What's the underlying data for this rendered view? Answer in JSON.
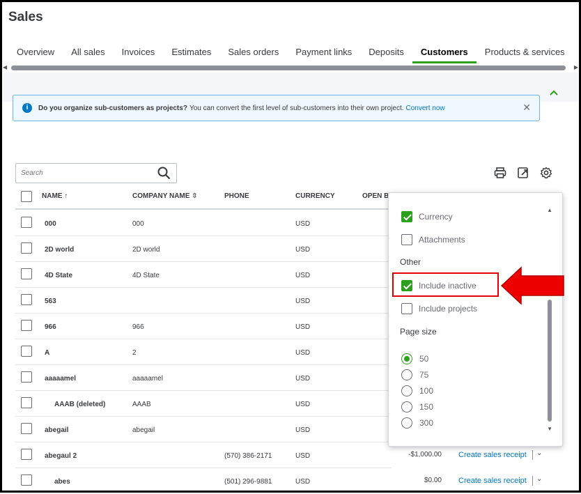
{
  "page": {
    "title": "Sales"
  },
  "tabs": [
    {
      "label": "Overview"
    },
    {
      "label": "All sales"
    },
    {
      "label": "Invoices"
    },
    {
      "label": "Estimates"
    },
    {
      "label": "Sales orders"
    },
    {
      "label": "Payment links"
    },
    {
      "label": "Deposits"
    },
    {
      "label": "Customers",
      "active": true
    },
    {
      "label": "Products & services"
    }
  ],
  "banner": {
    "bold_text": "Do you organize sub-customers as projects?",
    "text": "You can convert the first level of sub-customers into their own project.",
    "link": "Convert now"
  },
  "search": {
    "placeholder": "Search"
  },
  "table": {
    "headers": {
      "name": "NAME ↑",
      "company": "COMPANY NAME",
      "phone": "PHONE",
      "currency": "CURRENCY",
      "open_balance": "OPEN B"
    },
    "rows": [
      {
        "name": "000",
        "company": "000",
        "phone": "",
        "currency": "USD"
      },
      {
        "name": "2D world",
        "company": "2D world",
        "phone": "",
        "currency": "USD"
      },
      {
        "name": "4D State",
        "company": "4D State",
        "phone": "",
        "currency": "USD"
      },
      {
        "name": "563",
        "company": "",
        "phone": "",
        "currency": "USD"
      },
      {
        "name": "966",
        "company": "966",
        "phone": "",
        "currency": "USD"
      },
      {
        "name": "A",
        "company": "2",
        "phone": "",
        "currency": "USD"
      },
      {
        "name": "aaaaamel",
        "company": "aaaaamel",
        "phone": "",
        "currency": "USD"
      },
      {
        "name": "AAAB (deleted)",
        "company": "AAAB",
        "phone": "",
        "currency": "USD",
        "indent": true
      },
      {
        "name": "abegail",
        "company": "abegail",
        "phone": "",
        "currency": "USD"
      },
      {
        "name": "abegaul 2",
        "company": "",
        "phone": "(570) 386-2171",
        "currency": "USD",
        "balance": "-$1,000.00",
        "action": "Create sales receipt"
      },
      {
        "name": "abes",
        "company": "",
        "phone": "(501) 296-9881",
        "currency": "USD",
        "balance": "$0.00",
        "action": "Create sales receipt",
        "indent": true
      }
    ]
  },
  "settings_panel": {
    "columns": [
      {
        "label": "Currency",
        "checked": true
      },
      {
        "label": "Attachments",
        "checked": false
      }
    ],
    "other_heading": "Other",
    "other": [
      {
        "label": "Include inactive",
        "checked": true
      },
      {
        "label": "Include projects",
        "checked": false
      }
    ],
    "page_size_heading": "Page size",
    "page_sizes": [
      {
        "label": "50",
        "selected": true
      },
      {
        "label": "75",
        "selected": false
      },
      {
        "label": "100",
        "selected": false
      },
      {
        "label": "150",
        "selected": false
      },
      {
        "label": "300",
        "selected": false
      }
    ]
  },
  "colors": {
    "accent_green": "#2ca01c",
    "link_blue": "#0077c5",
    "annotation_red": "#e00000"
  }
}
